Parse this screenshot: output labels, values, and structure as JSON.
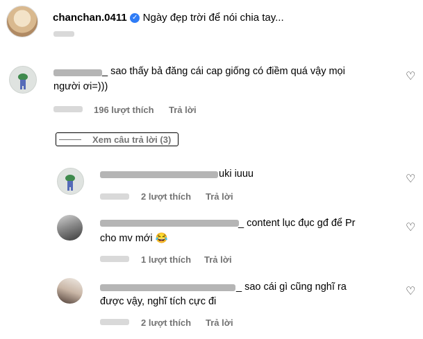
{
  "post": {
    "username": "chanchan.0411",
    "caption": "Ngày đẹp trời để nói chia tay..."
  },
  "comments": [
    {
      "text_line1": "_ sao thấy bả đăng cái cap giống có điềm quá vậy mọi",
      "text_line2": "người ơi=)))",
      "likes": "196 lượt thích",
      "reply": "Trả lời",
      "view_replies": "Xem câu trả lời (3)"
    }
  ],
  "replies": [
    {
      "text_line1": "uki iuuu",
      "likes": "2 lượt thích",
      "reply": "Trả lời"
    },
    {
      "text_line1": "_ content lục đục gđ để Pr",
      "text_line2": "cho mv mới",
      "emoji": "😂",
      "likes": "1 lượt thích",
      "reply": "Trả lời"
    },
    {
      "text_line1": "_ sao cái gì cũng nghĩ ra",
      "text_line2": "được vậy, nghĩ tích cực đi",
      "likes": "2 lượt thích",
      "reply": "Trả lời"
    }
  ],
  "icons": {
    "verified": "verified-badge-icon",
    "like": "heart-outline-icon"
  },
  "colors": {
    "verified": "#2f7cf6",
    "meta_text": "#737373"
  }
}
